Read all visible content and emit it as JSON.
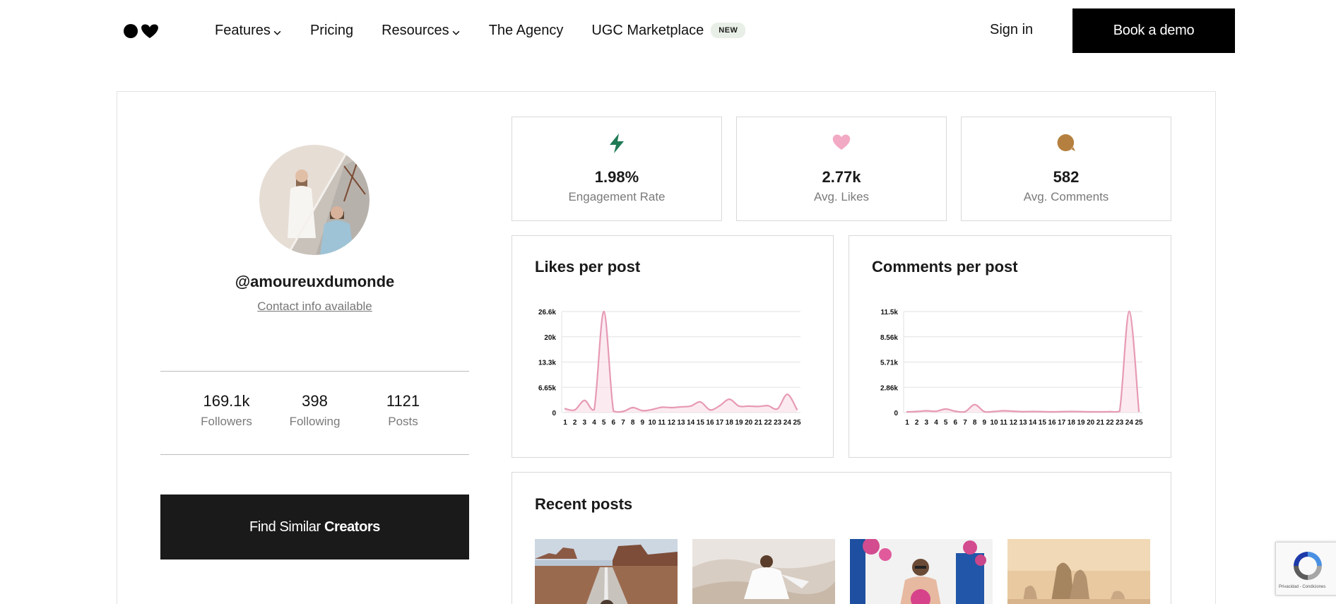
{
  "header": {
    "nav": [
      {
        "label": "Features",
        "dropdown": true
      },
      {
        "label": "Pricing",
        "dropdown": false
      },
      {
        "label": "Resources",
        "dropdown": true
      },
      {
        "label": "The Agency",
        "dropdown": false
      },
      {
        "label": "UGC Marketplace",
        "dropdown": false,
        "badge": "NEW"
      }
    ],
    "sign_in": "Sign in",
    "book_demo": "Book a demo"
  },
  "profile": {
    "handle": "@amoureuxdumonde",
    "contact": "Contact info available",
    "stats": [
      {
        "value": "169.1k",
        "label": "Followers"
      },
      {
        "value": "398",
        "label": "Following"
      },
      {
        "value": "1121",
        "label": "Posts"
      }
    ],
    "find_similar_prefix": "Find Similar ",
    "find_similar_bold": "Creators"
  },
  "metrics": [
    {
      "icon": "lightning-icon",
      "value": "1.98%",
      "label": "Engagement Rate",
      "color": "#1f7a55"
    },
    {
      "icon": "heart-icon",
      "value": "2.77k",
      "label": "Avg. Likes",
      "color": "#f2a9c4"
    },
    {
      "icon": "comment-icon",
      "value": "582",
      "label": "Avg. Comments",
      "color": "#b5803f"
    }
  ],
  "chart_data": [
    {
      "type": "area",
      "title": "Likes per post",
      "x": [
        1,
        2,
        3,
        4,
        5,
        6,
        7,
        8,
        9,
        10,
        11,
        12,
        13,
        14,
        15,
        16,
        17,
        18,
        19,
        20,
        21,
        22,
        23,
        24,
        25
      ],
      "yticks": [
        "0",
        "6.65k",
        "13.3k",
        "20k",
        "26.6k"
      ],
      "ylim": [
        0,
        26600
      ],
      "values": [
        1000,
        700,
        3200,
        800,
        26600,
        400,
        300,
        1300,
        500,
        800,
        1400,
        1300,
        1500,
        1700,
        2800,
        700,
        1800,
        3500,
        1700,
        1700,
        1600,
        1800,
        1000,
        4800,
        800
      ],
      "color": "#e79ab5"
    },
    {
      "type": "area",
      "title": "Comments per post",
      "x": [
        1,
        2,
        3,
        4,
        5,
        6,
        7,
        8,
        9,
        10,
        11,
        12,
        13,
        14,
        15,
        16,
        17,
        18,
        19,
        20,
        21,
        22,
        23,
        24,
        25
      ],
      "yticks": [
        "0",
        "2.86k",
        "5.71k",
        "8.56k",
        "11.5k"
      ],
      "ylim": [
        0,
        11500
      ],
      "values": [
        80,
        120,
        200,
        150,
        400,
        150,
        100,
        900,
        100,
        120,
        200,
        150,
        100,
        120,
        100,
        80,
        100,
        120,
        100,
        80,
        80,
        100,
        150,
        11500,
        150
      ],
      "color": "#e79ab5"
    }
  ],
  "recent_posts": {
    "title": "Recent posts"
  },
  "recaptcha": {
    "text": "Privacidad - Condiciones"
  }
}
